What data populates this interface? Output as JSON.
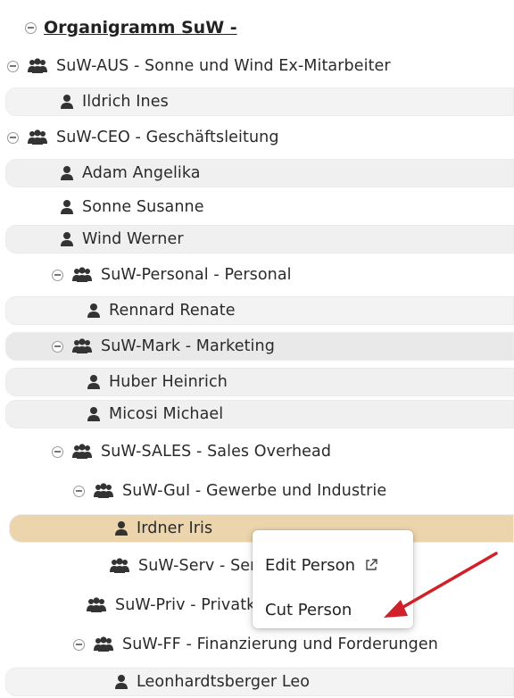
{
  "tree": {
    "title": "Organigramm SuW -",
    "nodes": [
      {
        "type": "group",
        "label": "SuW-AUS - Sonne und Wind Ex-Mitarbeiter"
      },
      {
        "type": "person",
        "label": "Ildrich Ines"
      },
      {
        "type": "group",
        "label": "SuW-CEO - Geschäftsleitung"
      },
      {
        "type": "person",
        "label": "Adam Angelika"
      },
      {
        "type": "person",
        "label": "Sonne Susanne"
      },
      {
        "type": "person",
        "label": "Wind Werner"
      },
      {
        "type": "group",
        "label": "SuW-Personal - Personal"
      },
      {
        "type": "person",
        "label": "Rennard Renate"
      },
      {
        "type": "group",
        "label": "SuW-Mark - Marketing"
      },
      {
        "type": "person",
        "label": "Huber Heinrich"
      },
      {
        "type": "person",
        "label": "Micosi Michael"
      },
      {
        "type": "group",
        "label": "SuW-SALES - Sales Overhead"
      },
      {
        "type": "group",
        "label": "SuW-GuI - Gewerbe und Industrie"
      },
      {
        "type": "person",
        "label": "Irdner Iris",
        "selected": true
      },
      {
        "type": "group",
        "label": "SuW-Serv - Service"
      },
      {
        "type": "group",
        "label": "SuW-Priv - Privatkunden"
      },
      {
        "type": "group",
        "label": "SuW-FF - Finanzierung und Forderungen"
      },
      {
        "type": "person",
        "label": "Leonhardtsberger Leo"
      }
    ]
  },
  "context_menu": {
    "edit_person": "Edit Person",
    "edit_icon": "external-link-icon",
    "cut_person": "Cut Person"
  },
  "colors": {
    "selected_row": "#ecd5ad",
    "arrow": "#d0202a"
  }
}
